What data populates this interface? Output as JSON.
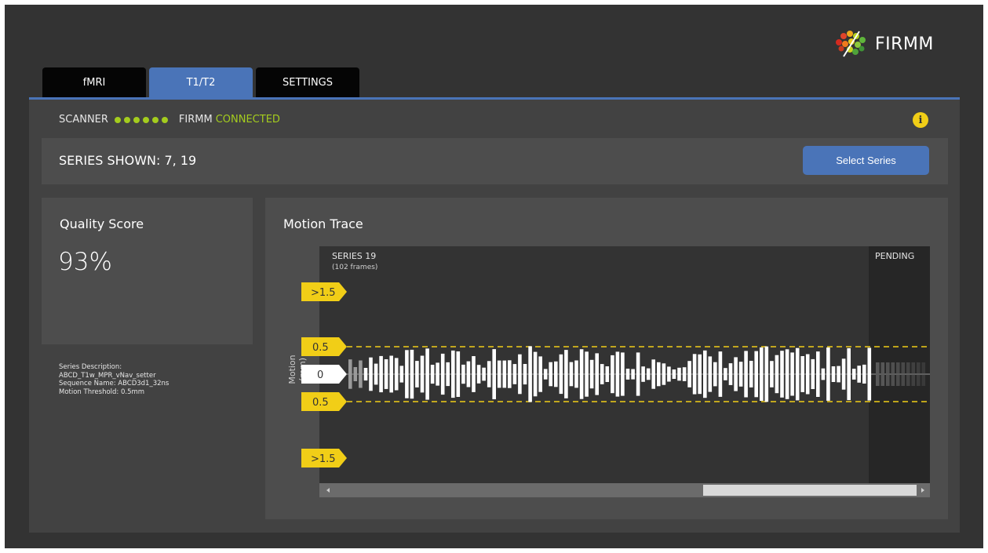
{
  "brand": {
    "name": "FIRMM",
    "logo_icon": "brain-logo-icon"
  },
  "tabs": [
    {
      "label": "fMRI",
      "active": false
    },
    {
      "label": "T1/T2",
      "active": true
    },
    {
      "label": "SETTINGS",
      "active": false
    }
  ],
  "status": {
    "scanner_label": "SCANNER",
    "scanner_dots": 6,
    "firmm_label": "FIRMM",
    "connection": "CONNECTED",
    "info_icon": "info-icon"
  },
  "series": {
    "shown": "SERIES SHOWN: 7, 19",
    "select_button": "Select Series"
  },
  "quality": {
    "title": "Quality Score",
    "value": "93%"
  },
  "description": {
    "line1": "Series Description:",
    "line2": "ABCD_T1w_MPR_vNav_setter",
    "line3": "Sequence Name: ABCD3d1_32ns",
    "line4": "Motion Threshold: 0.5mm"
  },
  "motion": {
    "title": "Motion Trace",
    "y_axis_label": "Motion (mm)",
    "series_label": "SERIES 19",
    "frames_label": "(102 frames)",
    "pending_label": "PENDING",
    "markers": {
      "upper_high": ">1.5",
      "upper_thr": "0.5",
      "zero": "0",
      "lower_thr": "0.5",
      "lower_high": ">1.5"
    }
  },
  "colors": {
    "accent_blue": "#4a74b8",
    "status_green": "#a4cc1e",
    "marker_yellow": "#f1ce17",
    "background": "#333333",
    "panel": "#424242"
  }
}
